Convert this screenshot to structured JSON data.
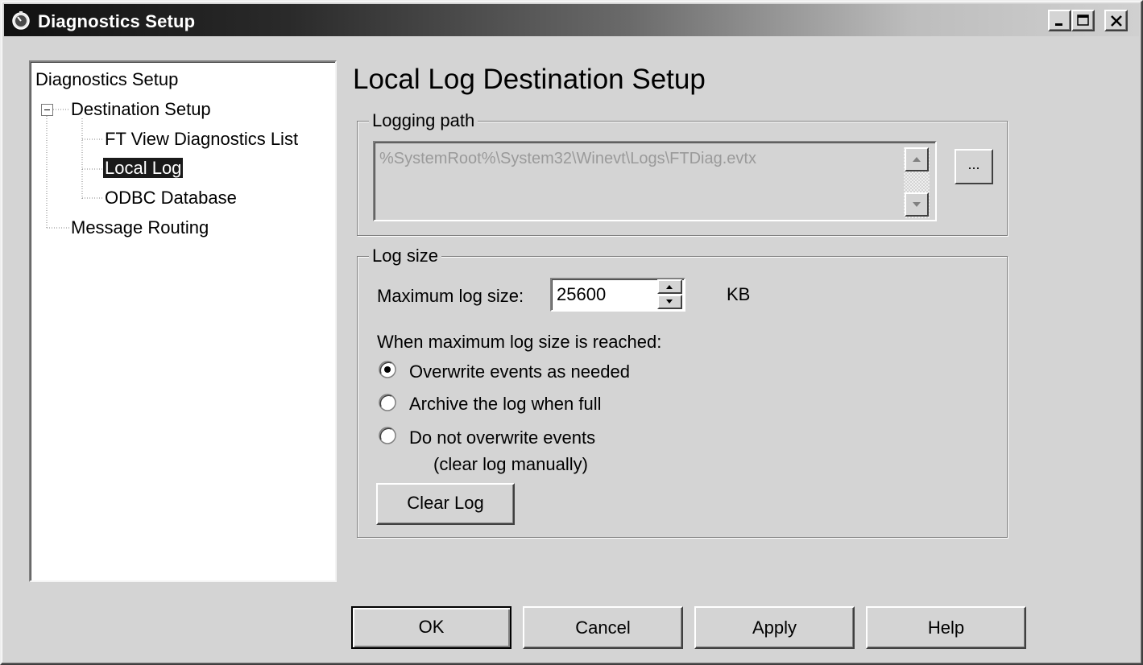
{
  "window": {
    "title": "Diagnostics Setup",
    "icon": "diagnostics-app-icon"
  },
  "tree": {
    "root": "Diagnostics Setup",
    "destination_setup": "Destination Setup",
    "ft_view_list": "FT View Diagnostics List",
    "local_log": "Local Log",
    "odbc_database": "ODBC Database",
    "message_routing": "Message Routing",
    "selected": "Local Log"
  },
  "page": {
    "title": "Local Log Destination Setup"
  },
  "logging_path": {
    "label": "Logging path",
    "value": "%SystemRoot%\\System32\\Winevt\\Logs\\FTDiag.evtx",
    "browse_label": "..."
  },
  "log_size": {
    "label": "Log size",
    "max_label": "Maximum log size:",
    "max_value": "25600",
    "unit": "KB",
    "when_reached_label": "When maximum log size is reached:",
    "options": [
      "Overwrite events as needed",
      "Archive the log when full",
      "Do not overwrite events"
    ],
    "option_3_note": "(clear log manually)",
    "selected_option": 0,
    "clear_log_label": "Clear Log"
  },
  "buttons": {
    "ok": "OK",
    "cancel": "Cancel",
    "apply": "Apply",
    "help": "Help"
  }
}
